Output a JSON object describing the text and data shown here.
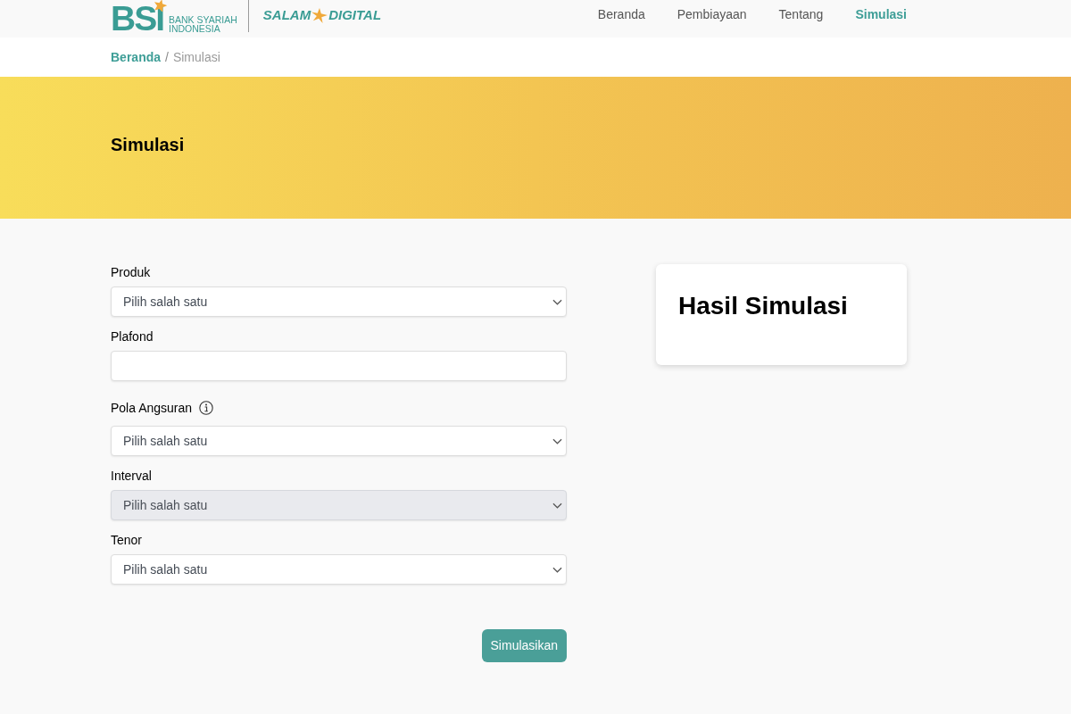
{
  "header": {
    "logo": {
      "mark": "BSI",
      "name_lines": [
        "BANK SYARIAH",
        "INDONESIA"
      ]
    },
    "partner_logo": {
      "left": "SALAM",
      "right": "DIGITAL"
    },
    "nav": [
      {
        "label": "Beranda",
        "selected": false
      },
      {
        "label": "Pembiayaan",
        "selected": false
      },
      {
        "label": "Tentang",
        "selected": false
      },
      {
        "label": "Simulasi",
        "selected": true
      }
    ]
  },
  "breadcrumb": {
    "items": [
      {
        "label": "Beranda",
        "kind": "link"
      },
      {
        "label": "Simulasi",
        "kind": "current"
      }
    ],
    "separator": "/"
  },
  "hero": {
    "title": "Simulasi"
  },
  "form": {
    "fields": [
      {
        "label": "Produk",
        "kind": "select",
        "placeholder": "Pilih salah satu",
        "disabled": false,
        "info": false
      },
      {
        "label": "Plafond",
        "kind": "text",
        "disabled": false,
        "info": false
      },
      {
        "label": "Pola Angsuran",
        "kind": "select",
        "placeholder": "Pilih salah satu",
        "disabled": false,
        "info": true
      },
      {
        "label": "Interval",
        "kind": "select",
        "placeholder": "Pilih salah satu",
        "disabled": true,
        "info": false
      },
      {
        "label": "Tenor",
        "kind": "select",
        "placeholder": "Pilih salah satu",
        "disabled": false,
        "info": false
      }
    ],
    "submit": "Simulasikan"
  },
  "result": {
    "title": "Hasil Simulasi"
  }
}
